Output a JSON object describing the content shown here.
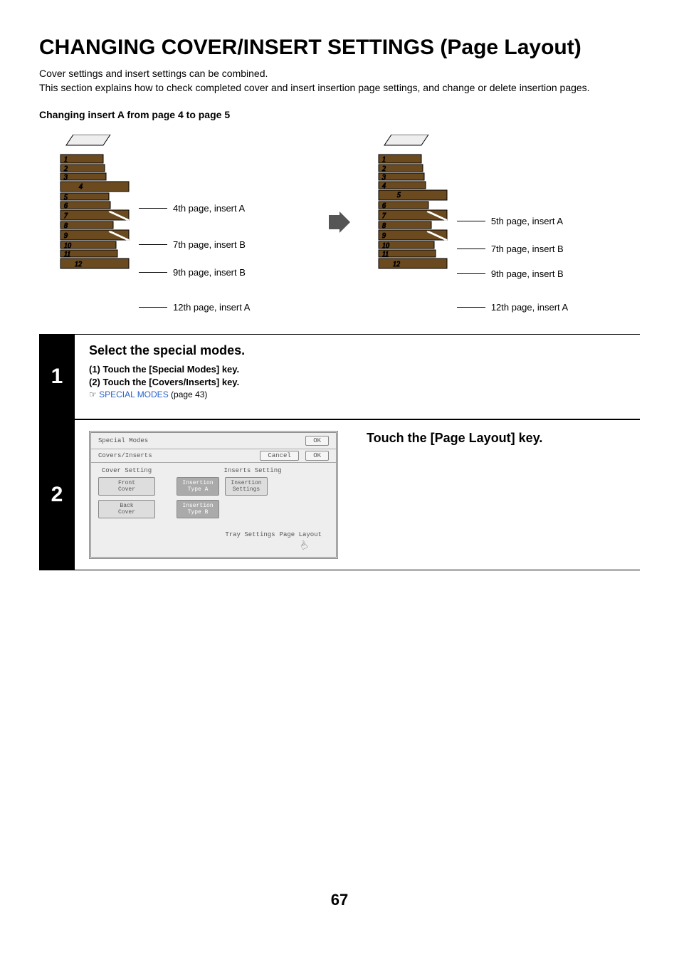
{
  "title": "CHANGING COVER/INSERT SETTINGS (Page Layout)",
  "intro1": "Cover settings and insert settings can be combined.",
  "intro2": "This section explains how to check completed cover and insert insertion page settings, and change or delete insertion pages.",
  "subheading": "Changing insert A from page 4 to page 5",
  "left_labels": [
    "4th page, insert A",
    "7th page, insert B",
    "9th page, insert B",
    "12th page, insert A"
  ],
  "right_labels": [
    "5th page, insert A",
    "7th page, insert B",
    "9th page, insert B",
    "12th page, insert A"
  ],
  "step1": {
    "num": "1",
    "title": "Select the special modes.",
    "sub1": "(1)  Touch the [Special Modes] key.",
    "sub2": "(2)  Touch the [Covers/Inserts] key.",
    "pointer": "☞",
    "link": "SPECIAL MODES",
    "link_suffix": " (page 43)"
  },
  "step2": {
    "num": "2",
    "title": "Touch the [Page Layout] key.",
    "panel": {
      "special_modes": "Special Modes",
      "ok": "OK",
      "covers_inserts": "Covers/Inserts",
      "cancel": "Cancel",
      "cover_setting": "Cover Setting",
      "inserts_setting": "Inserts Setting",
      "front_cover": "Front\nCover",
      "back_cover": "Back\nCover",
      "insertion_a": "Insertion\nType A",
      "insertion_b": "Insertion\nType B",
      "insertion_settings": "Insertion\nSettings",
      "tray_settings": "Tray Settings",
      "page_layout": "Page Layout"
    }
  },
  "page_number": "67"
}
